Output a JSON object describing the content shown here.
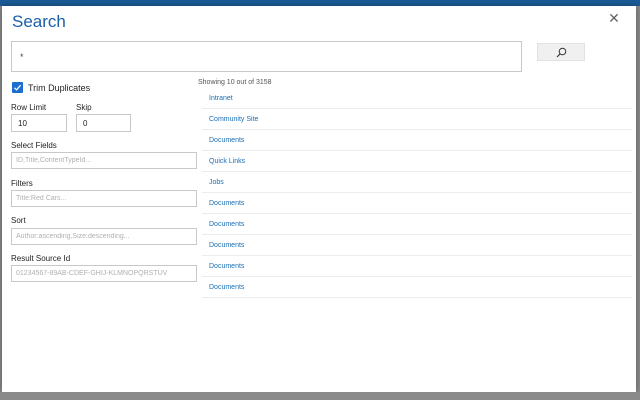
{
  "dialog": {
    "title": "Search",
    "close_glyph": "✕"
  },
  "search": {
    "query_value": "*",
    "button_icon": "search-icon"
  },
  "options": {
    "trim_duplicates_label": "Trim Duplicates",
    "trim_duplicates_checked": true,
    "row_limit_label": "Row Limit",
    "row_limit_value": "10",
    "skip_label": "Skip",
    "skip_value": "0",
    "select_fields_label": "Select Fields",
    "select_fields_placeholder": "ID,Title,ContentTypeId...",
    "filters_label": "Filters",
    "filters_placeholder": "Title:Red Cars...",
    "sort_label": "Sort",
    "sort_placeholder": "Author:ascending,Size:descending...",
    "result_source_label": "Result Source Id",
    "result_source_placeholder": "01234567-89AB-CDEF-GHIJ-KLMNOPQRSTUV"
  },
  "results": {
    "summary": "Showing 10 out of 3158",
    "items": [
      "Intranet",
      "Community Site",
      "Documents",
      "Quick Links",
      "Jobs",
      "Documents",
      "Documents",
      "Documents",
      "Documents",
      "Documents"
    ]
  },
  "colors": {
    "accent": "#1a5fa8",
    "link": "#1a6fb5",
    "checkbox": "#1a6fd0"
  }
}
